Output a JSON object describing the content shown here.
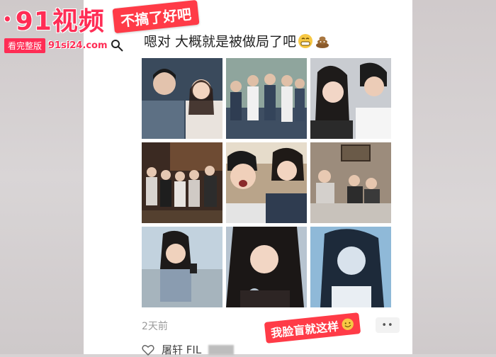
{
  "watermark": {
    "logo_text": "91视频",
    "tag_text": "看完整版",
    "url": "91si24.com"
  },
  "banner_top": "不搞了好吧",
  "post": {
    "text": "嗯对 大概就是被做局了吧",
    "time": "2天前",
    "more_label": "••"
  },
  "banner_bottom": "我脸盲就这样",
  "comment": {
    "author": "屠轩 FIL"
  },
  "photos": [
    {
      "name": "photo-1"
    },
    {
      "name": "photo-2"
    },
    {
      "name": "photo-3"
    },
    {
      "name": "photo-4"
    },
    {
      "name": "photo-5"
    },
    {
      "name": "photo-6"
    },
    {
      "name": "photo-7"
    },
    {
      "name": "photo-8"
    },
    {
      "name": "photo-9"
    }
  ],
  "colors": {
    "accent": "#ff2d55",
    "banner": "#ff3b47"
  },
  "icons": [
    "search-icon",
    "grin-emoji-icon",
    "poop-emoji-icon",
    "smile-emoji-icon",
    "heart-icon"
  ]
}
